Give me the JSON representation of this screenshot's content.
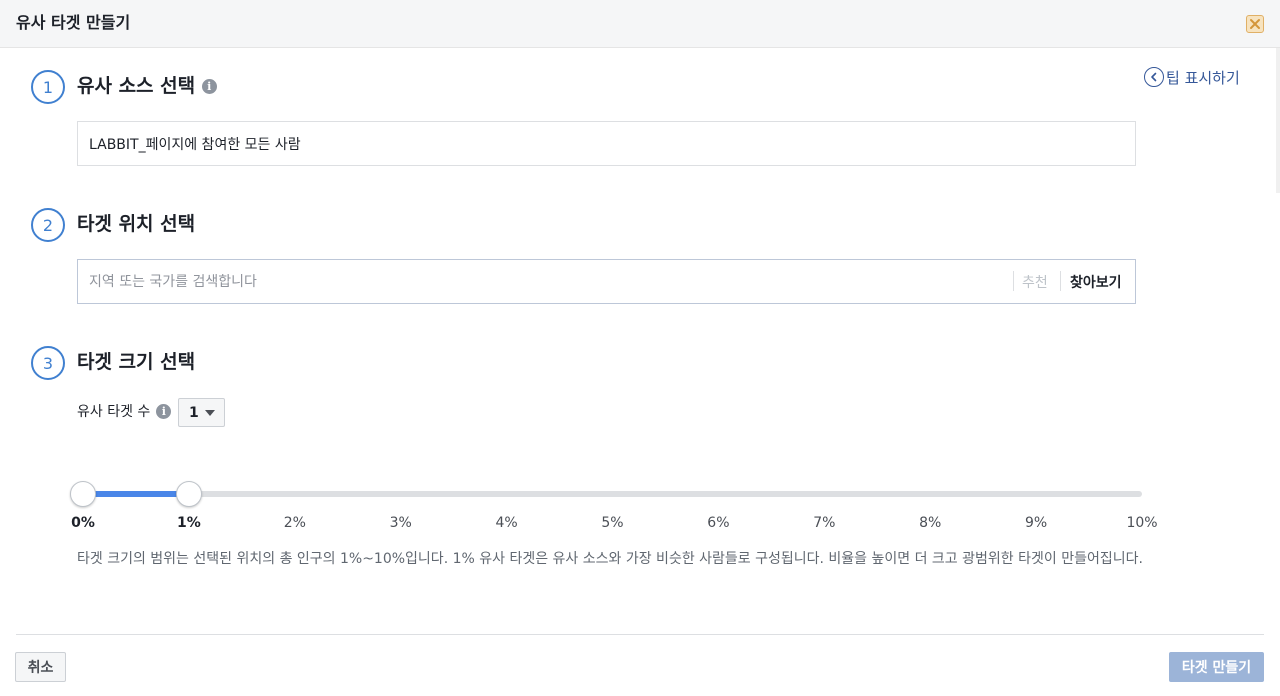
{
  "dialog": {
    "title": "유사 타겟 만들기",
    "tip_link": "팁 표시하기"
  },
  "steps": [
    {
      "number": "1",
      "title": "유사 소스 선택"
    },
    {
      "number": "2",
      "title": "타겟 위치 선택"
    },
    {
      "number": "3",
      "title": "타겟 크기 선택"
    }
  ],
  "source": {
    "value": "LABBIT_페이지에 참여한 모든 사람"
  },
  "location": {
    "placeholder": "지역 또는 국가를 검색합니다",
    "recommend_label": "추천",
    "browse_label": "찾아보기"
  },
  "size": {
    "count_label": "유사 타겟 수",
    "count_value": "1",
    "slider_min_percent": 0,
    "slider_selected_percent": 1,
    "slider_max_percent": 10,
    "ticks": [
      "0%",
      "1%",
      "2%",
      "3%",
      "4%",
      "5%",
      "6%",
      "7%",
      "8%",
      "9%",
      "10%"
    ],
    "description": "타겟 크기의 범위는 선택된 위치의 총 인구의 1%~10%입니다. 1% 유사 타겟은 유사 소스와 가장 비슷한 사람들로 구성됩니다. 비율을 높이면 더 크고 광범위한 타겟이 만들어집니다."
  },
  "footer": {
    "cancel_label": "취소",
    "create_label": "타겟 만들기"
  },
  "colors": {
    "accent": "#4080d0",
    "link": "#365899",
    "slider_fill": "#4a86e8",
    "create_disabled": "#9cb4d8"
  },
  "icons": {
    "close": "close-icon",
    "tip": "chevron-left-circle-icon",
    "info": "info-icon",
    "caret": "caret-down-icon"
  }
}
